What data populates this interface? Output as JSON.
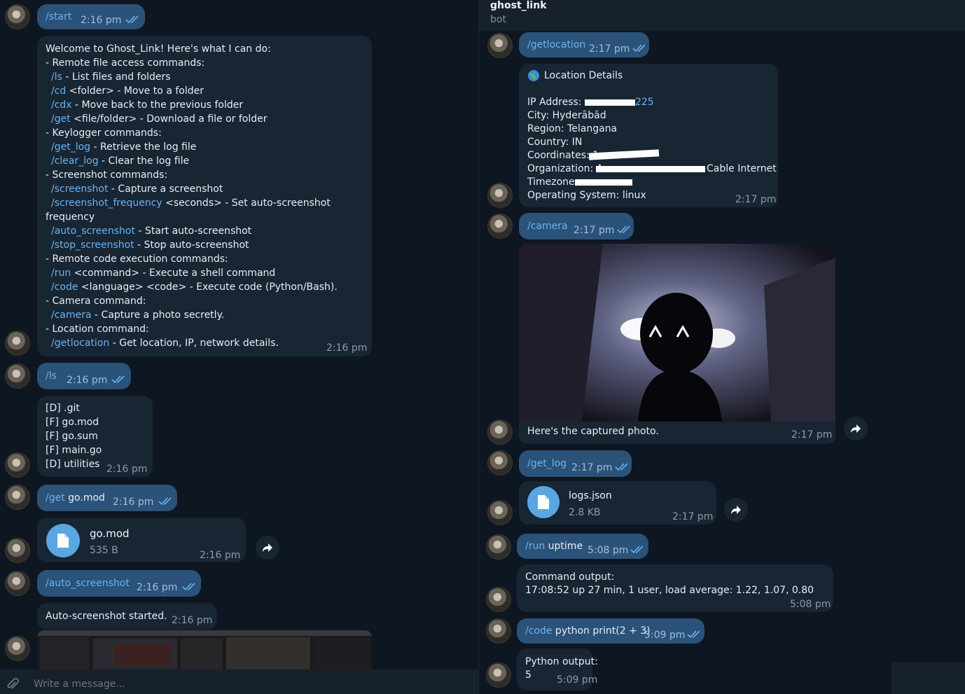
{
  "header": {
    "title": "ghost_link",
    "subtitle": "bot"
  },
  "composer": {
    "placeholder": "Write a message..."
  },
  "left": {
    "start": {
      "cmd": "/start",
      "time": "2:16 pm"
    },
    "help": {
      "lines": [
        {
          "text": "Welcome to Ghost_Link! Here's what I can do:"
        },
        {
          "text": "- Remote file access commands:"
        },
        {
          "cmd": "/ls",
          "text": " - List files and folders"
        },
        {
          "cmd": "/cd",
          "text": " <folder> - Move to a folder"
        },
        {
          "cmd": "/cdx",
          "text": " - Move back to the previous folder"
        },
        {
          "cmd": "/get",
          "text": " <file/folder> - Download a file or folder"
        },
        {
          "text": "- Keylogger commands:"
        },
        {
          "cmd": "/get_log",
          "text": " - Retrieve the log file"
        },
        {
          "cmd": "/clear_log",
          "text": " - Clear the log file"
        },
        {
          "text": "- Screenshot commands:"
        },
        {
          "cmd": "/screenshot",
          "text": " - Capture a screenshot"
        },
        {
          "cmd": "/screenshot_frequency",
          "text": " <seconds> - Set auto-screenshot"
        },
        {
          "text": "frequency"
        },
        {
          "cmd": "/auto_screenshot",
          "text": " - Start auto-screenshot"
        },
        {
          "cmd": "/stop_screenshot",
          "text": " - Stop auto-screenshot"
        },
        {
          "text": "- Remote code execution commands:"
        },
        {
          "cmd": "/run",
          "text": " <command> - Execute a shell command"
        },
        {
          "cmd": "/code",
          "text": " <language> <code> - Execute code (Python/Bash)."
        },
        {
          "text": "- Camera command:"
        },
        {
          "cmd": "/camera",
          "text": " - Capture a photo secretly."
        },
        {
          "text": "- Location command:"
        },
        {
          "cmd": "/getlocation",
          "text": " - Get location, IP, network details."
        }
      ],
      "time": "2:16 pm"
    },
    "ls": {
      "cmd": "/ls",
      "time": "2:16 pm"
    },
    "ls_result": {
      "lines": [
        "[D] .git",
        "[F] go.mod",
        "[F] go.sum",
        "[F] main.go",
        "[D] utilities"
      ],
      "time": "2:16 pm"
    },
    "get": {
      "cmd": "/get",
      "arg": " go.mod",
      "time": "2:16 pm"
    },
    "file": {
      "name": "go.mod",
      "size": "535 B",
      "time": "2:16 pm"
    },
    "auto": {
      "cmd": "/auto_screenshot",
      "time": "2:16 pm"
    },
    "auto_result": {
      "text": "Auto-screenshot started.",
      "time": "2:16 pm"
    }
  },
  "right": {
    "getlocation": {
      "cmd": "/getlocation",
      "time": "2:17 pm"
    },
    "location": {
      "title": "Location Details",
      "ip_label": "IP Address: ",
      "ip_visible": "225",
      "city": "City: Hyderābād",
      "region": "Region: Telangana",
      "country": "Country: IN",
      "coords_label": "Coordinates: 1",
      "org_label": "Organization: A",
      "org_tail": "Cable Internet",
      "tz_label": "Timezone: ",
      "os": "Operating System: linux",
      "time": "2:17 pm"
    },
    "camera": {
      "cmd": "/camera",
      "time": "2:17 pm"
    },
    "photo": {
      "caption": "Here's the captured photo.",
      "time": "2:17 pm"
    },
    "get_log": {
      "cmd": "/get_log",
      "time": "2:17 pm"
    },
    "logfile": {
      "name": "logs.json",
      "size": "2.8 KB",
      "time": "2:17 pm"
    },
    "run": {
      "cmd": "/run",
      "arg": " uptime",
      "time": "5:08 pm"
    },
    "run_result": {
      "label": "Command output:",
      "output": " 17:08:52 up 27 min,  1 user,  load average: 1.22, 1.07, 0.80",
      "time": "5:08 pm"
    },
    "code": {
      "cmd": "/code",
      "arg": " python print(2 + 3)",
      "time": "5:09 pm"
    },
    "code_result": {
      "label": "Python output:",
      "output": "5",
      "time": "5:09 pm"
    }
  },
  "colors": {
    "background": "#0e1621",
    "outgoing": "#2b5278",
    "incoming": "#182533",
    "link": "#6ab3f3"
  },
  "icons": [
    "double-check-icon",
    "file-icon",
    "forward-icon",
    "paperclip-icon",
    "globe-icon"
  ]
}
